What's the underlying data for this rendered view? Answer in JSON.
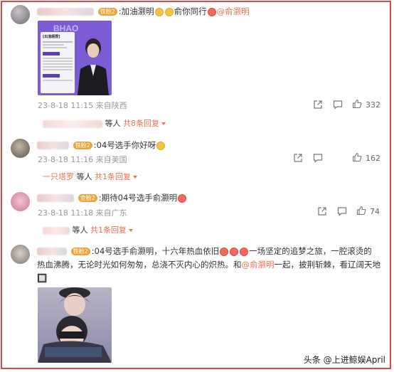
{
  "comments": [
    {
      "text": ":加油灏明",
      "emoji_count": 2,
      "text_after": "俞你同行",
      "mention": "@俞灏明",
      "badge": "铁粉2",
      "image_caption_top": "BHAO",
      "image_caption_title": "[出道經歷]",
      "time": "23-8-18 11:15",
      "location": "来自陕西",
      "likes": "332",
      "reply_suffix": "等人",
      "reply_link": "共8条回复"
    },
    {
      "text": ":04号选手你好呀",
      "badge": "铁粉2",
      "time": "23-8-18 11:16",
      "location": "来自美国",
      "likes": "162",
      "reply_user": "一只塔罗",
      "reply_suffix": "等人",
      "reply_link": "共1条回复"
    },
    {
      "text": ":期待04号选手俞灏明",
      "badge": "金粉2",
      "time": "23-8-18 11:18",
      "location": "来自广东",
      "likes": "74",
      "reply_suffix": "等人",
      "reply_link": "共1条回复"
    },
    {
      "text_line1_a": ":04号选手俞灏明，十六年热血依旧",
      "text_line1_b": "一场坚定的追梦之旅，一腔滚烫的",
      "text_line2_a": "热血沸腾，无论时光如何匆匆，总浇不灭内心的炽热。和",
      "mention": "@俞灏明",
      "text_line2_b": "一起，披荆斩棘，看辽阔天地",
      "text_line3": "🔲",
      "badge": "铁粉2"
    }
  ],
  "watermark": "头条 @上进鲸娱April"
}
